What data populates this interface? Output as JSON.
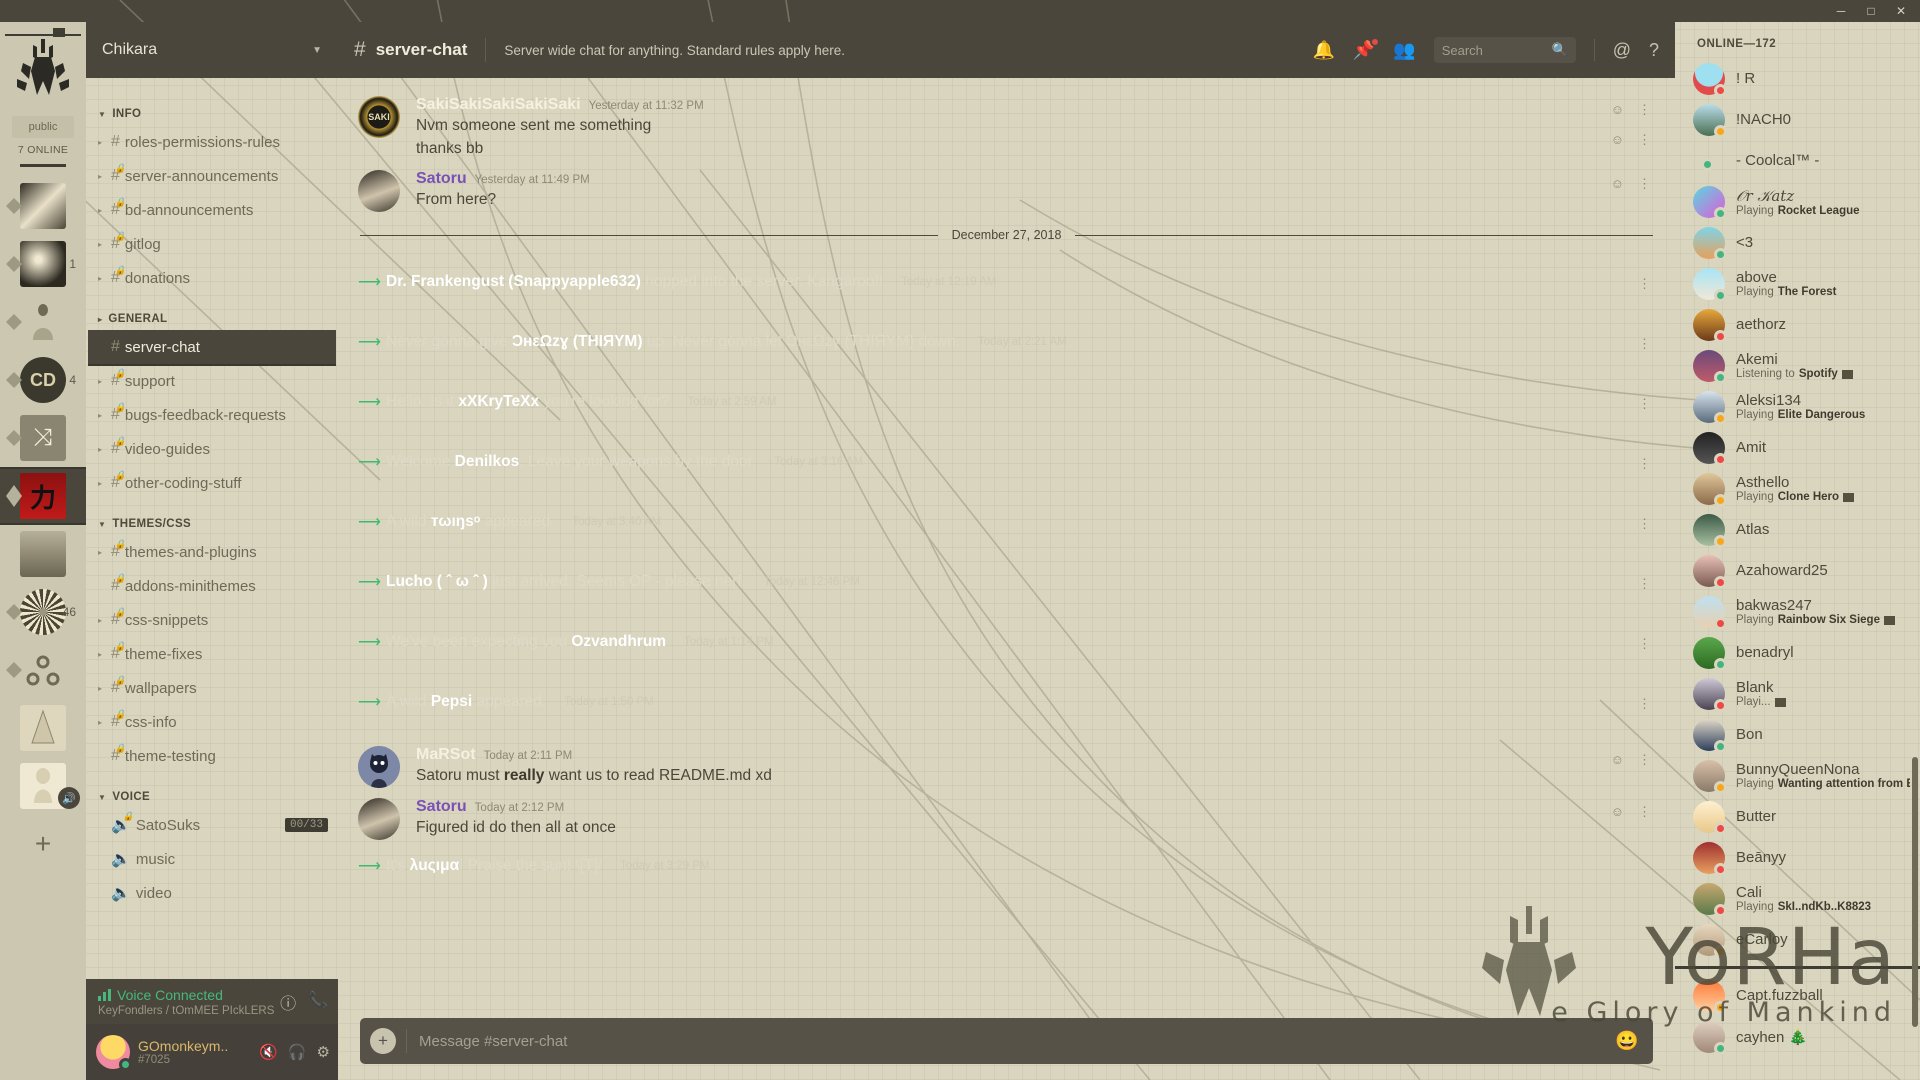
{
  "window": {
    "minimize": "─",
    "maximize": "□",
    "close": "✕"
  },
  "rail": {
    "public_label": "public",
    "online_label": "7 ONLINE",
    "add_label": "+",
    "guilds": [
      {
        "name": "guild-1",
        "badge": ""
      },
      {
        "name": "guild-2",
        "badge": "1"
      },
      {
        "name": "guild-3",
        "badge": ""
      },
      {
        "name": "guild-4",
        "badge": "4"
      },
      {
        "name": "guild-5",
        "badge": ""
      },
      {
        "name": "chikara",
        "badge": "",
        "selected": true
      },
      {
        "name": "guild-7",
        "badge": ""
      },
      {
        "name": "guild-8",
        "badge": "46"
      },
      {
        "name": "guild-9",
        "badge": ""
      },
      {
        "name": "guild-10",
        "badge": ""
      },
      {
        "name": "guild-11",
        "badge": "",
        "muted": true
      }
    ]
  },
  "sidebar": {
    "server_name": "Chikara",
    "categories": [
      {
        "label": "INFO",
        "collapsed": false,
        "channels": [
          {
            "name": "roles-permissions-rules",
            "locked": false,
            "unreadArrow": true
          },
          {
            "name": "server-announcements",
            "locked": true,
            "unreadArrow": true
          },
          {
            "name": "bd-announcements",
            "locked": true,
            "unreadArrow": true
          },
          {
            "name": "gitlog",
            "locked": true,
            "unreadArrow": true
          },
          {
            "name": "donations",
            "locked": true,
            "unreadArrow": true
          }
        ]
      },
      {
        "label": "GENERAL",
        "collapsed": true,
        "channels": [
          {
            "name": "server-chat",
            "locked": false,
            "active": true
          },
          {
            "name": "support",
            "locked": true,
            "unreadArrow": true
          },
          {
            "name": "bugs-feedback-requests",
            "locked": true,
            "unreadArrow": true
          },
          {
            "name": "video-guides",
            "locked": true,
            "unreadArrow": true
          },
          {
            "name": "other-coding-stuff",
            "locked": true,
            "unreadArrow": true
          }
        ]
      },
      {
        "label": "THEMES/CSS",
        "collapsed": false,
        "channels": [
          {
            "name": "themes-and-plugins",
            "locked": true,
            "unreadArrow": true
          },
          {
            "name": "addons-minithemes",
            "locked": true,
            "unreadArrow": false
          },
          {
            "name": "css-snippets",
            "locked": true,
            "unreadArrow": true
          },
          {
            "name": "theme-fixes",
            "locked": true,
            "unreadArrow": true
          },
          {
            "name": "wallpapers",
            "locked": true,
            "unreadArrow": true
          },
          {
            "name": "css-info",
            "locked": true,
            "unreadArrow": true
          },
          {
            "name": "theme-testing",
            "locked": true,
            "unreadArrow": false
          }
        ]
      },
      {
        "label": "VOICE",
        "collapsed": false,
        "channels": [
          {
            "name": "SatoSuks",
            "voice": true,
            "locked": true,
            "limit": "00/33"
          },
          {
            "name": "music",
            "voice": true,
            "locked": false
          },
          {
            "name": "video",
            "voice": true,
            "locked": false
          }
        ]
      }
    ],
    "voice_panel": {
      "status": "Voice Connected",
      "route": "KeyFondlers / tOmMEE PIckLERS",
      "info_icon": "info-icon",
      "disconnect_icon": "disconnect-icon"
    },
    "user": {
      "name": "GOmonkeym..",
      "tag": "#7025",
      "mic_icon": "mic-muted-icon",
      "headset_icon": "headset-icon",
      "settings_icon": "gear-icon"
    }
  },
  "header": {
    "hash": "#",
    "channel": "server-chat",
    "topic": "Server wide chat for anything. Standard rules apply here.",
    "icons": {
      "bell": "bell-icon",
      "pin": "pin-icon",
      "members": "members-icon",
      "mention": "@",
      "help": "?"
    },
    "search_placeholder": "Search"
  },
  "chat": {
    "divider_date": "December 27, 2018",
    "messages": [
      {
        "type": "user",
        "author": "SakiSakiSakiSakiSaki",
        "author_color": "#f5f1e0",
        "timestamp": "Yesterday at 11:32 PM",
        "lines": [
          "Nvm someone sent me something",
          "thanks bb"
        ],
        "avatar": "saki"
      },
      {
        "type": "user",
        "author": "Satoru",
        "author_color": "#7a51b5",
        "timestamp": "Yesterday at 11:49 PM",
        "lines": [
          "From here?"
        ],
        "avatar": "satoru"
      },
      {
        "type": "divider",
        "label": "December 27, 2018"
      },
      {
        "type": "system",
        "pre": "",
        "name": "Dr. Frankengust (Snappyapple632)",
        "post": " hopped into the server. Kangaroo!!",
        "timestamp": "Today at 12:19 AM"
      },
      {
        "type": "system",
        "pre": "Never gonna give ",
        "name": "ƆнεΩzɣ (ТНІЯYM)",
        "post": " up. Never gonna let ƆнεΩzɣ (ТНІЯYM) down.",
        "timestamp": "Today at 2:21 AM"
      },
      {
        "type": "system",
        "pre": "Hello. Is it ",
        "name": "xXKryTeXx",
        "post": " you're looking for?",
        "timestamp": "Today at 2:59 AM"
      },
      {
        "type": "system",
        "pre": "Welcome ",
        "name": "Denilkos",
        "post": ". Leave your weapons by the door.",
        "timestamp": "Today at 3:16 AM"
      },
      {
        "type": "system",
        "pre": "A wild ",
        "name": "тωıŋsᵒ",
        "post": "  appeared.",
        "timestamp": "Today at 3:40 AM"
      },
      {
        "type": "system",
        "pre": "",
        "name": "Lucho ( ˆ ω ˆ )",
        "post": " just arrived. Seems OP - please nerf.",
        "timestamp": "Today at 12:46 PM"
      },
      {
        "type": "system",
        "pre": "We've been expecting you ",
        "name": "Ozvandhrum",
        "post": "",
        "timestamp": "Today at 1:14 PM"
      },
      {
        "type": "system",
        "pre": "A wild ",
        "name": "Pepsi",
        "post": " appeared.",
        "timestamp": "Today at 1:50 PM"
      },
      {
        "type": "user",
        "author": "MaRSot",
        "author_color": "#f5f1e0",
        "timestamp": "Today at 2:11 PM",
        "lines_rich": [
          {
            "pre": "Satoru must ",
            "bold": "really",
            "post": " want us to read README.md xd"
          }
        ],
        "avatar": "marsot"
      },
      {
        "type": "user",
        "author": "Satoru",
        "author_color": "#7a51b5",
        "timestamp": "Today at 2:12 PM",
        "lines": [
          "Figured id do then all at once"
        ],
        "avatar": "satoru"
      },
      {
        "type": "system",
        "pre": "It's ",
        "name": "λuςιμα",
        "post": "! Praise the sun! \\[T]/",
        "timestamp": "Today at 3:29 PM"
      }
    ],
    "composer_placeholder": "Message #server-chat",
    "composer_plus": "+",
    "composer_emoji": "☺"
  },
  "members": {
    "title": "ONLINE—172",
    "list": [
      {
        "name": "! R",
        "status": "dnd",
        "activity": "",
        "ava": "#d8e9f0"
      },
      {
        "name": "!NACH0",
        "status": "idle",
        "activity": "",
        "ava": "#cfe3e8"
      },
      {
        "name": "- Coolcal™ -",
        "status": "online",
        "activity": "",
        "ava": "none"
      },
      {
        "name": "𝒪r 𝒦atz",
        "status": "online",
        "activity_prefix": "Playing",
        "activity": "Rocket League",
        "ava": "#d95ad0"
      },
      {
        "name": "<3",
        "status": "online",
        "activity": "",
        "ava": "#e8b07a"
      },
      {
        "name": "above",
        "status": "online",
        "activity_prefix": "Playing",
        "activity": "The Forest",
        "ava": "#9fdcf0"
      },
      {
        "name": "aethorz",
        "status": "dnd",
        "activity": "",
        "ava": "#c6843c"
      },
      {
        "name": "Akemi",
        "status": "online",
        "activity_prefix": "Listening to",
        "activity": "Spotify",
        "badge": true,
        "ava": "#8b5f8d"
      },
      {
        "name": "Aleksi134",
        "status": "idle",
        "activity_prefix": "Playing",
        "activity": "Elite Dangerous",
        "ava": "#b9c8d4"
      },
      {
        "name": "Amit",
        "status": "dnd",
        "activity": "",
        "ava": "#2a2a2a"
      },
      {
        "name": "Asthello",
        "status": "idle",
        "activity_prefix": "Playing",
        "activity": "Clone Hero",
        "badge": true,
        "ava": "#c9a882"
      },
      {
        "name": "Atlas",
        "status": "idle",
        "activity": "",
        "ava": "#3c5a47"
      },
      {
        "name": "Azahoward25",
        "status": "dnd",
        "activity": "",
        "ava": "#d6a6a0"
      },
      {
        "name": "bakwas247",
        "status": "dnd",
        "activity_prefix": "Playing",
        "activity": "Rainbow Six Siege",
        "badge": true,
        "ava": "#a8cfe0"
      },
      {
        "name": "benadryl",
        "status": "online",
        "activity": "",
        "ava": "#5ba84c"
      },
      {
        "name": "Blank",
        "status": "dnd",
        "activity_prefix": "Playi...",
        "activity": "",
        "badge": true,
        "ava": "#6a6270"
      },
      {
        "name": "Bon",
        "status": "online",
        "activity": "",
        "ava": "#38506e"
      },
      {
        "name": "BunnyQueenNona",
        "status": "idle",
        "activity_prefix": "Playing",
        "activity": "Wanting attention from Eth..",
        "ava": "#c9b39a"
      },
      {
        "name": "Butter",
        "status": "dnd",
        "activity": "",
        "ava": "#f0e0c0"
      },
      {
        "name": "Beānуу",
        "status": "dnd",
        "activity": "",
        "ava": "#8b3a3a"
      },
      {
        "name": "Cali",
        "status": "dnd",
        "activity_prefix": "Playing",
        "activity": "SkI..ndKb..K8823",
        "ava": "#b89a6a"
      },
      {
        "name": "eCarloy",
        "status": "idle",
        "activity": "",
        "ava": "#d2c0a8"
      },
      {
        "name": "Capt.fuzzball",
        "status": "idle",
        "activity": "",
        "ava": "#e05a2a",
        "after_sep": false,
        "before_sep": true
      },
      {
        "name": "cayhen 🎄",
        "status": "online",
        "activity": "",
        "ava": "#cbb9a5"
      }
    ]
  },
  "watermark": {
    "line1": "YoRHa",
    "line2": "e Glory of Mankind"
  },
  "colors": {
    "bg": "#d9d5bf",
    "panel": "#4a463c",
    "accent_green": "#3fba6d",
    "accent_purple": "#7a51b5",
    "name_gold": "#d9b86a",
    "status_online": "#43b581",
    "status_idle": "#faa61a",
    "status_dnd": "#f04747"
  }
}
